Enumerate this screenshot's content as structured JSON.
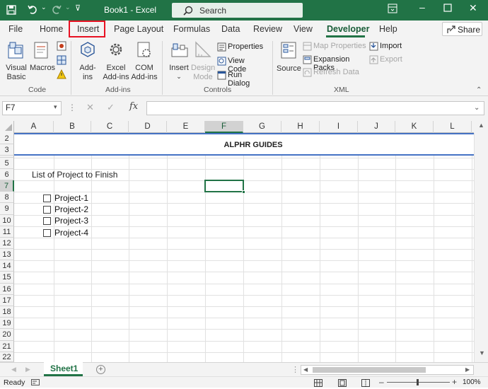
{
  "window": {
    "title": "Book1  -  Excel",
    "search_placeholder": "Search",
    "accent": "#217346"
  },
  "menu": {
    "tabs": [
      "File",
      "Home",
      "Insert",
      "Page Layout",
      "Formulas",
      "Data",
      "Review",
      "View",
      "Developer",
      "Help"
    ],
    "share": "Share",
    "highlighted_tab": "Insert",
    "highlight_color": "#e81123"
  },
  "ribbon": {
    "code": {
      "visual_basic": [
        "Visual",
        "Basic"
      ],
      "macros": "Macros",
      "label": "Code"
    },
    "addins": {
      "addins": [
        "Add-",
        "ins"
      ],
      "excel_addins": [
        "Excel",
        "Add-ins"
      ],
      "com_addins": [
        "COM",
        "Add-ins"
      ],
      "label": "Add-ins"
    },
    "controls": {
      "insert": "Insert",
      "design_mode": [
        "Design",
        "Mode"
      ],
      "properties": "Properties",
      "view_code": "View Code",
      "run_dialog": "Run Dialog",
      "label": "Controls"
    },
    "xml": {
      "source": "Source",
      "map_properties": "Map Properties",
      "expansion_packs": "Expansion Packs",
      "refresh_data": "Refresh Data",
      "import": "Import",
      "export": "Export",
      "label": "XML"
    }
  },
  "formula_bar": {
    "name_box": "F7",
    "fx": "fx",
    "value": ""
  },
  "grid": {
    "columns": [
      "A",
      "B",
      "C",
      "D",
      "E",
      "F",
      "G",
      "H",
      "I",
      "J",
      "K",
      "L"
    ],
    "rows": [
      "2",
      "3",
      "5",
      "6",
      "7",
      "8",
      "9",
      "10",
      "11",
      "12",
      "13",
      "14",
      "15",
      "16",
      "17",
      "18",
      "19",
      "20",
      "21",
      "22"
    ],
    "selected_cell": "F7",
    "banner": "ALPHR GUIDES",
    "list_title": "List of Project to Finish",
    "checkboxes": [
      {
        "label": "Project-1",
        "checked": false
      },
      {
        "label": "Project-2",
        "checked": false
      },
      {
        "label": "Project-3",
        "checked": false
      },
      {
        "label": "Project-4",
        "checked": false
      }
    ]
  },
  "sheets": {
    "active": "Sheet1"
  },
  "status": {
    "mode": "Ready",
    "zoom": "100%"
  }
}
